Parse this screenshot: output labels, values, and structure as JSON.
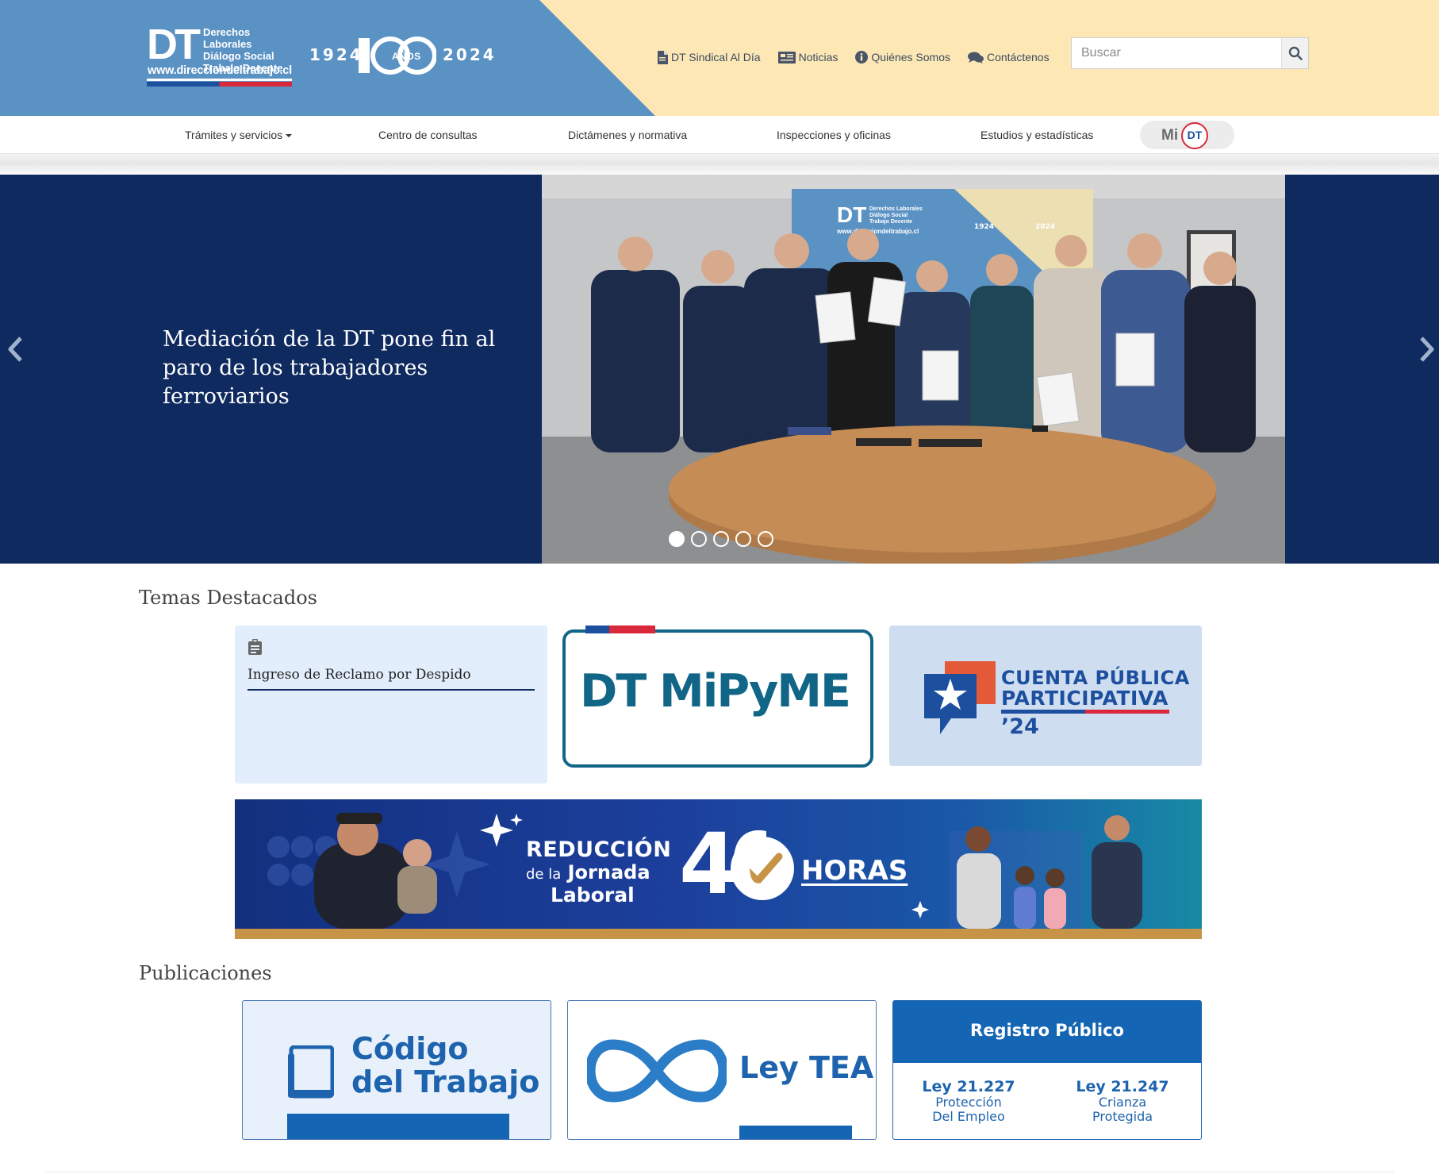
{
  "header": {
    "logo": {
      "mark": "DT",
      "lines": [
        "Derechos Laborales",
        "Diálogo Social",
        "Trabajo Decente"
      ],
      "url": "www.direcciondeltrabajo.cl"
    },
    "anniversary": {
      "year_start": "1924",
      "number": "100",
      "anos": "AÑOS",
      "year_end": "2024"
    },
    "links": [
      {
        "label": "DT Sindical Al Día",
        "icon": "document-icon"
      },
      {
        "label": "Noticias",
        "icon": "newspaper-icon"
      },
      {
        "label": "Quiénes Somos",
        "icon": "info-icon"
      },
      {
        "label": "Contáctenos",
        "icon": "chat-icon"
      }
    ],
    "search": {
      "placeholder": "Buscar",
      "value": "",
      "icon": "search-icon"
    },
    "colors": {
      "blue": "#5b92c4",
      "cream": "#fde8b5"
    }
  },
  "mainnav": {
    "items": [
      {
        "label": "Trámites y servicios"
      },
      {
        "label": "Centro de consultas"
      },
      {
        "label": "Dictámenes y normativa"
      },
      {
        "label": "Inspecciones y oficinas"
      },
      {
        "label": "Estudios y estadísticas"
      }
    ],
    "midt": {
      "mi": "Mi",
      "dt": "DT"
    }
  },
  "carousel": {
    "title": "Mediación de la DT pone fin al paro de los trabajadores ferroviarios",
    "photo_banner": {
      "mark": "DT",
      "lines": [
        "Derechos Laborales",
        "Diálogo Social",
        "Trabajo Decente"
      ],
      "url": "www.direcciondeltrabajo.cl",
      "year_start": "1924",
      "year_end": "2024"
    },
    "slide_count": 5,
    "active_index": 0,
    "background": "#0f2a5f"
  },
  "destacados": {
    "title": "Temas Destacados",
    "reclamo": {
      "label": "Ingreso de Reclamo por Despido",
      "icon": "clipboard-icon"
    },
    "mipyme": {
      "text": "DT MiPyME"
    },
    "cuenta": {
      "line1": "CUENTA PÚBLICA",
      "line2": "PARTICIPATIVA",
      "line3": "’24"
    },
    "jornada": {
      "line1": "REDUCCIÓN",
      "line2_small": "de la",
      "line2": "Jornada",
      "line3": "Laboral",
      "number": "40",
      "horas": "HORAS"
    }
  },
  "publicaciones": {
    "title": "Publicaciones",
    "codigo": {
      "line1": "Código",
      "line2": "del Trabajo",
      "icon": "book-icon"
    },
    "tea": {
      "text": "Ley TEA",
      "icon": "infinity-icon"
    },
    "registro": {
      "title": "Registro Público",
      "laws": [
        {
          "law": "Ley 21.227",
          "desc1": "Protección",
          "desc2": "Del Empleo"
        },
        {
          "law": "Ley 21.247",
          "desc1": "Crianza",
          "desc2": "Protegida"
        }
      ]
    }
  }
}
